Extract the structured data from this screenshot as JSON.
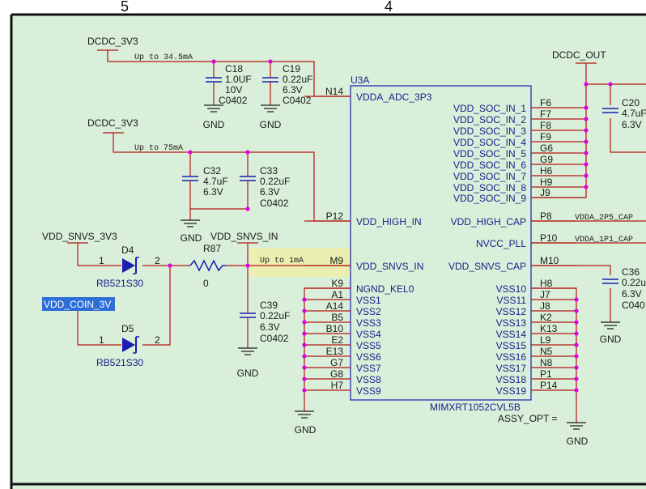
{
  "palette": {
    "background": "#d9efd9",
    "wire": "#b31616",
    "pin": "#b31616",
    "junction": "#e000e0",
    "chip_border": "#1c1cb0",
    "label_blue": "#1c1c8c",
    "label_dark": "#1a1a1a",
    "highlight": "#ebf0b0",
    "selection": "#2e6fd6"
  },
  "zones": {
    "left": "5",
    "right": "4"
  },
  "chip": {
    "ref": "U3A",
    "part": "MIMXRT1052CVL5B",
    "assy": "ASSY_OPT =",
    "left_pins": [
      {
        "num": "N14",
        "name": "VDDA_ADC_3P3"
      },
      {
        "num": "P12",
        "name": "VDD_HIGH_IN"
      },
      {
        "num": "M9",
        "name": "VDD_SNVS_IN"
      },
      {
        "num": "K9",
        "name": "NGND_KEL0"
      },
      {
        "num": "A1",
        "name": "VSS1"
      },
      {
        "num": "A14",
        "name": "VSS2"
      },
      {
        "num": "B5",
        "name": "VSS3"
      },
      {
        "num": "B10",
        "name": "VSS4"
      },
      {
        "num": "E2",
        "name": "VSS5"
      },
      {
        "num": "E13",
        "name": "VSS6"
      },
      {
        "num": "G7",
        "name": "VSS7"
      },
      {
        "num": "G8",
        "name": "VSS8"
      },
      {
        "num": "H7",
        "name": "VSS9"
      }
    ],
    "right_pins": [
      {
        "num": "F6",
        "name": "VDD_SOC_IN_1"
      },
      {
        "num": "F7",
        "name": "VDD_SOC_IN_2"
      },
      {
        "num": "F8",
        "name": "VDD_SOC_IN_3"
      },
      {
        "num": "F9",
        "name": "VDD_SOC_IN_4"
      },
      {
        "num": "G6",
        "name": "VDD_SOC_IN_5"
      },
      {
        "num": "G9",
        "name": "VDD_SOC_IN_6"
      },
      {
        "num": "H6",
        "name": "VDD_SOC_IN_7"
      },
      {
        "num": "H9",
        "name": "VDD_SOC_IN_8"
      },
      {
        "num": "J9",
        "name": "VDD_SOC_IN_9"
      },
      {
        "num": "P8",
        "name": "VDD_HIGH_CAP"
      },
      {
        "num": "P10",
        "name": "NVCC_PLL"
      },
      {
        "num": "M10",
        "name": "VDD_SNVS_CAP"
      },
      {
        "num": "H8",
        "name": "VSS10"
      },
      {
        "num": "J7",
        "name": "VSS11"
      },
      {
        "num": "J8",
        "name": "VSS12"
      },
      {
        "num": "K2",
        "name": "VSS13"
      },
      {
        "num": "K13",
        "name": "VSS14"
      },
      {
        "num": "L9",
        "name": "VSS15"
      },
      {
        "num": "N5",
        "name": "VSS16"
      },
      {
        "num": "N8",
        "name": "VSS17"
      },
      {
        "num": "P1",
        "name": "VSS18"
      },
      {
        "num": "P14",
        "name": "VSS19"
      }
    ]
  },
  "nets": {
    "dcdc_3v3_top": "DCDC_3V3",
    "dcdc_3v3_mid": "DCDC_3V3",
    "dcdc_out": "DCDC_OUT",
    "vdd_snvs_3v3": "VDD_SNVS_3V3",
    "vdd_snvs_in": "VDD_SNVS_IN",
    "vdd_coin_3v": "VDD_COIN_3V",
    "vdda_2p5_cap": "VDDA_2P5_CAP",
    "vdda_1p1_cap": "VDDA_1P1_CAP"
  },
  "currents": {
    "adc": "Up to 34.5mA",
    "high": "Up to 75mA",
    "snvs": "Up to 1mA"
  },
  "gnd_label": "GND",
  "capacitors": [
    {
      "id": "c18",
      "ref": "C18",
      "value": "1.0UF",
      "voltage": "10V",
      "package": "C0402"
    },
    {
      "id": "c19",
      "ref": "C19",
      "value": "0.22uF",
      "voltage": "6.3V",
      "package": "C0402"
    },
    {
      "id": "c32",
      "ref": "C32",
      "value": "4.7uF",
      "voltage": "6.3V",
      "package": ""
    },
    {
      "id": "c33",
      "ref": "C33",
      "value": "0.22uF",
      "voltage": "6.3V",
      "package": "C0402"
    },
    {
      "id": "c39",
      "ref": "C39",
      "value": "0.22uF",
      "voltage": "6.3V",
      "package": "C0402"
    },
    {
      "id": "c20",
      "ref": "C20",
      "value": "4.7uF",
      "voltage": "6.3V",
      "package": ""
    },
    {
      "id": "c36",
      "ref": "C36",
      "value": "0.22u",
      "voltage": "6.3V",
      "package": "C040"
    }
  ],
  "diodes": [
    {
      "id": "d4",
      "ref": "D4",
      "part": "RB521S30",
      "pin1": "1",
      "pin2": "2"
    },
    {
      "id": "d5",
      "ref": "D5",
      "part": "RB521S30",
      "pin1": "1",
      "pin2": "2"
    }
  ],
  "resistor": {
    "ref": "R87",
    "value": "0"
  }
}
